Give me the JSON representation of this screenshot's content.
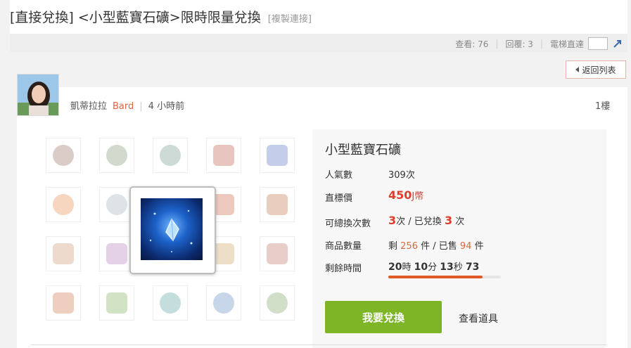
{
  "header": {
    "title": "[直接兌換] <小型藍寶石礦>限時限量兌換",
    "copy_link": "[複製連接]"
  },
  "stats": {
    "views_label": "查看: 76",
    "replies_label": "回覆: 3",
    "jump_label": "電梯直達"
  },
  "nav": {
    "back_label": "返回列表"
  },
  "post": {
    "author": "凱蒂拉拉",
    "author_class": "Bard",
    "time": "4 小時前",
    "floor": "1樓"
  },
  "grid_items": [
    {
      "icon": "gem-orb-icon",
      "color": "#7a4a3a"
    },
    {
      "icon": "gem-orb-icon",
      "color": "#5a7a4a"
    },
    {
      "icon": "gem-orb-icon",
      "color": "#4a7a6a"
    },
    {
      "icon": "red-book-icon",
      "color": "#b0301c"
    },
    {
      "icon": "blue-book-icon",
      "color": "#2a4ab0"
    },
    {
      "icon": "fire-orb-icon",
      "color": "#e06a1a"
    },
    {
      "icon": "silver-orb-icon",
      "color": "#8a9aa8"
    },
    {
      "icon": "blue-gem-icon",
      "color": "#1a4ac0"
    },
    {
      "icon": "flower-icon",
      "color": "#c03a1a"
    },
    {
      "icon": "flower-icon",
      "color": "#b0501a"
    },
    {
      "icon": "leaf-icon",
      "color": "#c07a4a"
    },
    {
      "icon": "feather-icon",
      "color": "#a05aa0"
    },
    {
      "icon": "blue-gem-icon",
      "color": "#1a4ac0"
    },
    {
      "icon": "crystal-icon",
      "color": "#c08a3a"
    },
    {
      "icon": "crystal-icon",
      "color": "#b04a3a"
    },
    {
      "icon": "wand-icon",
      "color": "#c0501a"
    },
    {
      "icon": "wand-icon",
      "color": "#5a9a2a"
    },
    {
      "icon": "shell-icon",
      "color": "#2a8a8a"
    },
    {
      "icon": "shell-icon",
      "color": "#3a6ab0"
    },
    {
      "icon": "shell-icon",
      "color": "#5a8a3a"
    }
  ],
  "featured": {
    "icon": "small-blue-sapphire-ore-icon"
  },
  "detail": {
    "name": "小型藍寶石礦",
    "popularity_label": "人氣數",
    "popularity_value": "309次",
    "price_label": "直標價",
    "price_value": "450",
    "price_unit": "J幣",
    "limit_label": "可總換次數",
    "limit_value": "3",
    "limit_unit": "次 / 已兌換",
    "redeemed_value": "3",
    "redeemed_unit": "次",
    "stock_label": "商品數量",
    "stock_prefix": "剩",
    "stock_left": "256",
    "stock_mid": "件 / 已售",
    "stock_sold": "94",
    "stock_suffix": "件",
    "time_label": "剩餘時間",
    "time_hours": "20",
    "time_hours_unit": "時",
    "time_minutes": "10",
    "time_minutes_unit": "分",
    "time_seconds": "13",
    "time_seconds_unit": "秒",
    "time_ticks": "73",
    "time_remaining_fraction": 0.84
  },
  "actions": {
    "redeem_label": "我要兌換",
    "view_item_label": "查看道具"
  },
  "colors": {
    "accent_green": "#7db527",
    "price_red": "#e03c2c",
    "class_orange": "#e0643c",
    "timebar": "#e05a28"
  }
}
